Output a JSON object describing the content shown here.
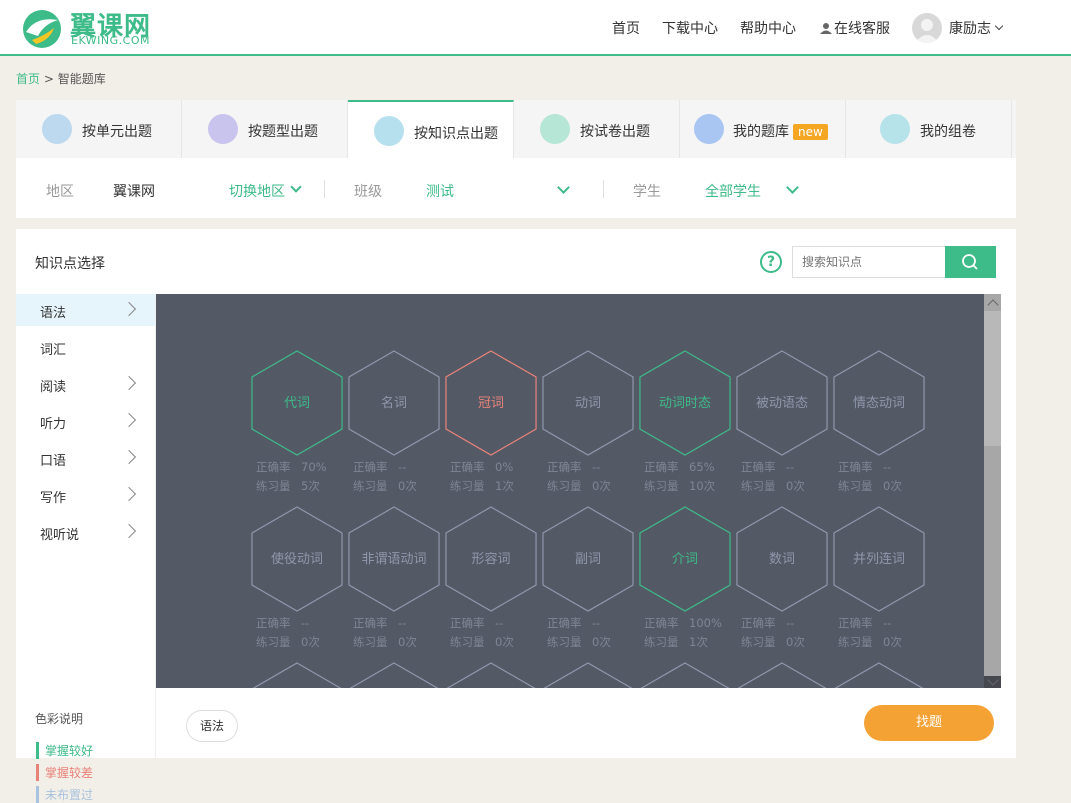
{
  "header": {
    "brand": "翼课网",
    "brand_sub": "EKWING.COM",
    "nav": [
      "首页",
      "下载中心",
      "帮助中心",
      "在线客服"
    ],
    "user_name": "康励志"
  },
  "breadcrumb": {
    "home": "首页",
    "sep": ">",
    "current": "智能题库"
  },
  "tabs": [
    {
      "label": "按单元出题",
      "color": "#bcd9f0"
    },
    {
      "label": "按题型出题",
      "color": "#c9c4ee"
    },
    {
      "label": "按知识点出题",
      "color": "#b6e0ee"
    },
    {
      "label": "按试卷出题",
      "color": "#b6e6d6"
    },
    {
      "label": "我的题库",
      "color": "#a9c6f2",
      "badge": "new"
    },
    {
      "label": "我的组卷",
      "color": "#b6e2ea"
    }
  ],
  "filter": {
    "region_label": "地区",
    "region_value": "翼课网",
    "switch_region": "切换地区",
    "class_label": "班级",
    "class_value": "测试",
    "student_label": "学生",
    "student_value": "全部学生"
  },
  "panel": {
    "title": "知识点选择",
    "search_placeholder": "搜索知识点",
    "help": "?"
  },
  "sidebar": [
    {
      "label": "语法",
      "arrow": true
    },
    {
      "label": "词汇",
      "arrow": false
    },
    {
      "label": "阅读",
      "arrow": true
    },
    {
      "label": "听力",
      "arrow": true
    },
    {
      "label": "口语",
      "arrow": true
    },
    {
      "label": "写作",
      "arrow": true
    },
    {
      "label": "视听说",
      "arrow": true
    }
  ],
  "legend": {
    "title": "色彩说明",
    "items": [
      {
        "label": "掌握较好",
        "color": "#3dbb88"
      },
      {
        "label": "掌握较差",
        "color": "#e8837a"
      },
      {
        "label": "未布置过",
        "color": "#a9c2dd"
      }
    ]
  },
  "stat_labels": {
    "accuracy": "正确率",
    "count": "练习量"
  },
  "knowledge_points": [
    {
      "name": "代词",
      "accuracy": "70%",
      "count": "5次",
      "status": "good"
    },
    {
      "name": "名词",
      "accuracy": "--",
      "count": "0次",
      "status": "none"
    },
    {
      "name": "冠词",
      "accuracy": "0%",
      "count": "1次",
      "status": "poor"
    },
    {
      "name": "动词",
      "accuracy": "--",
      "count": "0次",
      "status": "none"
    },
    {
      "name": "动词时态",
      "accuracy": "65%",
      "count": "10次",
      "status": "good"
    },
    {
      "name": "被动语态",
      "accuracy": "--",
      "count": "0次",
      "status": "none"
    },
    {
      "name": "情态动词",
      "accuracy": "--",
      "count": "0次",
      "status": "none"
    },
    {
      "name": "使役动词",
      "accuracy": "--",
      "count": "0次",
      "status": "none"
    },
    {
      "name": "非谓语动词",
      "accuracy": "--",
      "count": "0次",
      "status": "none"
    },
    {
      "name": "形容词",
      "accuracy": "--",
      "count": "0次",
      "status": "none"
    },
    {
      "name": "副词",
      "accuracy": "--",
      "count": "0次",
      "status": "none"
    },
    {
      "name": "介词",
      "accuracy": "100%",
      "count": "1次",
      "status": "good"
    },
    {
      "name": "数词",
      "accuracy": "--",
      "count": "0次",
      "status": "none"
    },
    {
      "name": "并列连词",
      "accuracy": "--",
      "count": "0次",
      "status": "none"
    }
  ],
  "status_colors": {
    "good": "#3dbb88",
    "poor": "#e8837a",
    "none": "#8e97ab"
  },
  "footer": {
    "selected_tag": "语法",
    "find_button": "找题"
  }
}
